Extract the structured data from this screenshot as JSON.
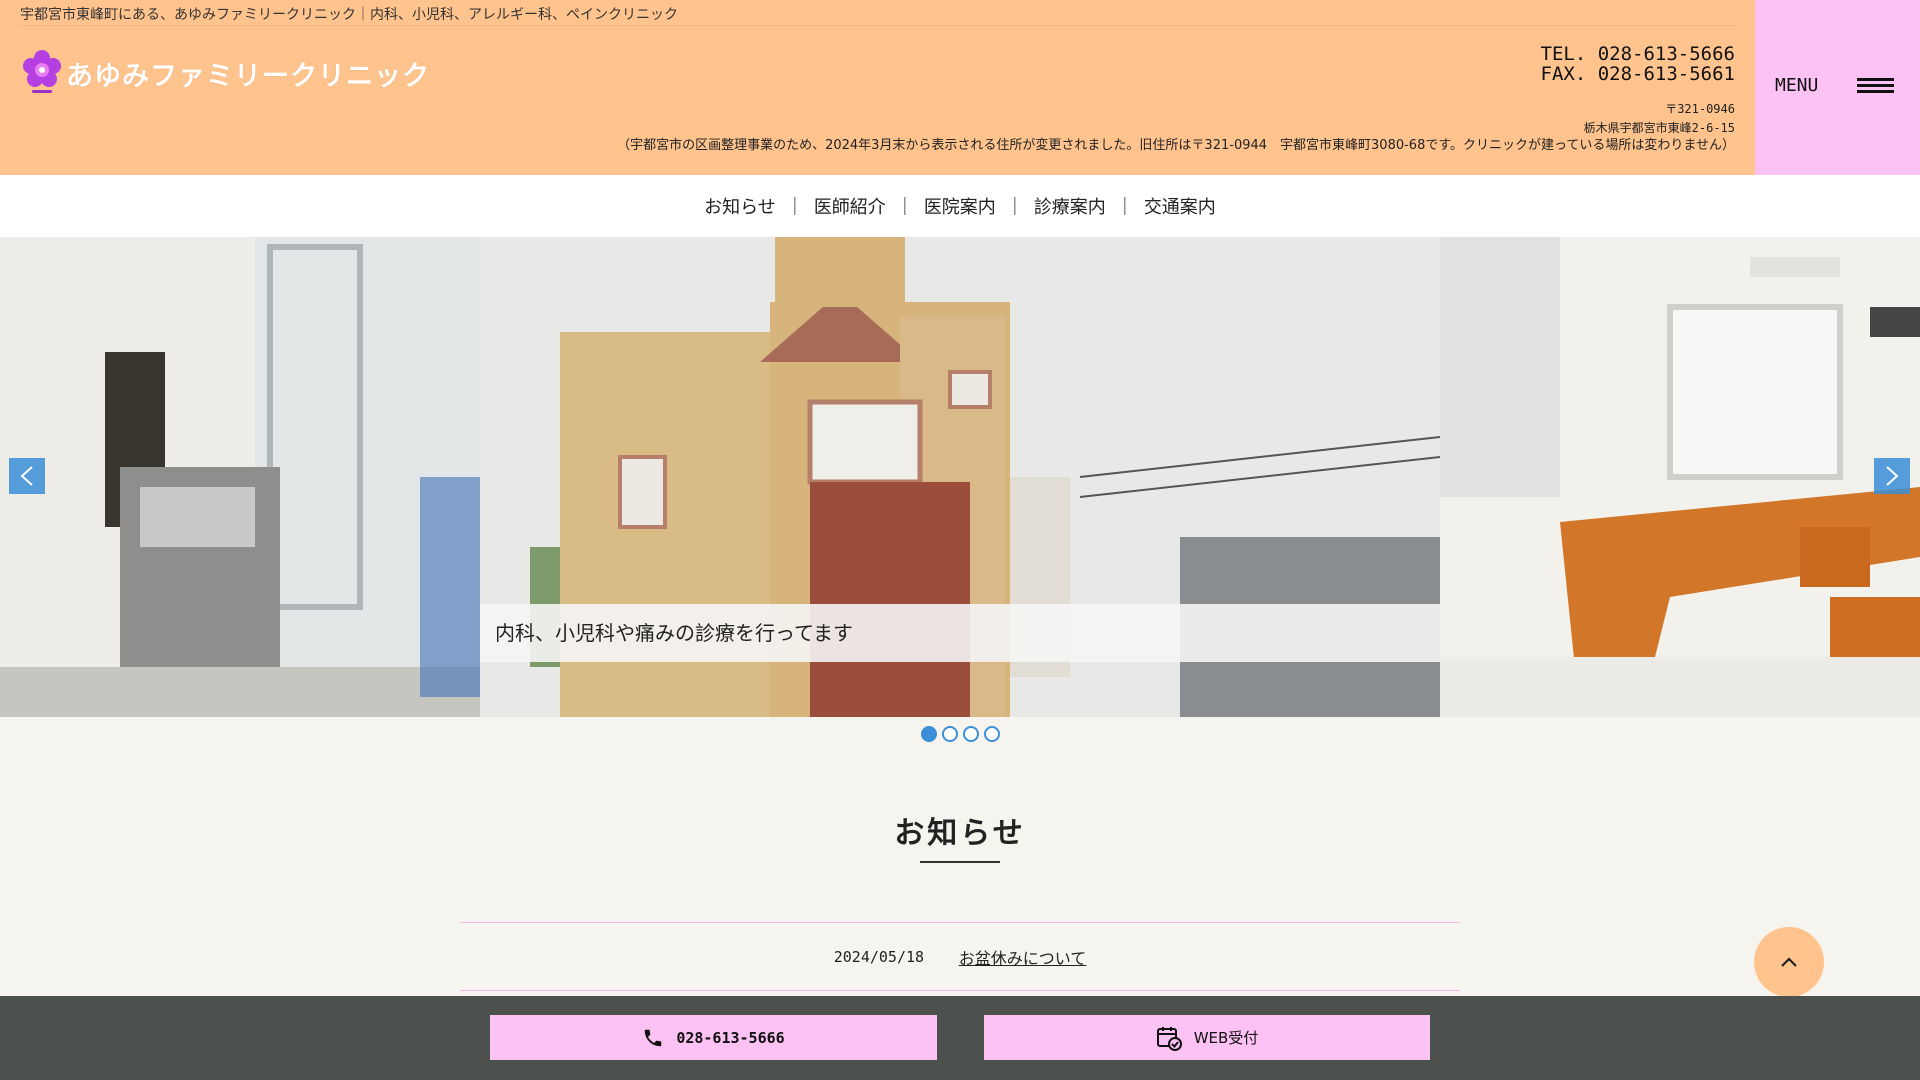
{
  "header": {
    "tagline": "宇都宮市東峰町にある、あゆみファミリークリニック｜内科、小児科、アレルギー科、ペインクリニック",
    "logo_text": "あゆみファミリークリニック",
    "tel": "TEL. 028-613-5666",
    "fax": "FAX. 028-613-5661",
    "postal_code": "〒321-0946",
    "address": "栃木県宇都宮市東峰2-6-15",
    "address_notice": "（宇都宮市の区画整理事業のため、2024年3月末から表示される住所が変更されました。旧住所は〒321-0944　宇都宮市東峰町3080-68です。クリニックが建っている場所は変わりません）",
    "menu_label": "MENU"
  },
  "nav": {
    "items": [
      "お知らせ",
      "医師紹介",
      "医院案内",
      "診療案内",
      "交通案内"
    ],
    "separator": "｜"
  },
  "slider": {
    "caption": "内科、小児科や痛みの診療を行ってます",
    "dot_count": 4,
    "active_dot": 0
  },
  "news": {
    "title": "お知らせ",
    "items": [
      {
        "date": "2024/05/18",
        "title": "お盆休みについて"
      }
    ]
  },
  "bottom_bar": {
    "tel_label": "028-613-5666",
    "web_label": "WEB受付"
  },
  "colors": {
    "header_bg": "#ffc38e",
    "menu_bg": "#fcc2f3",
    "accent_blue": "#3a8fd8",
    "bottom_bar_bg": "#4d514d"
  }
}
